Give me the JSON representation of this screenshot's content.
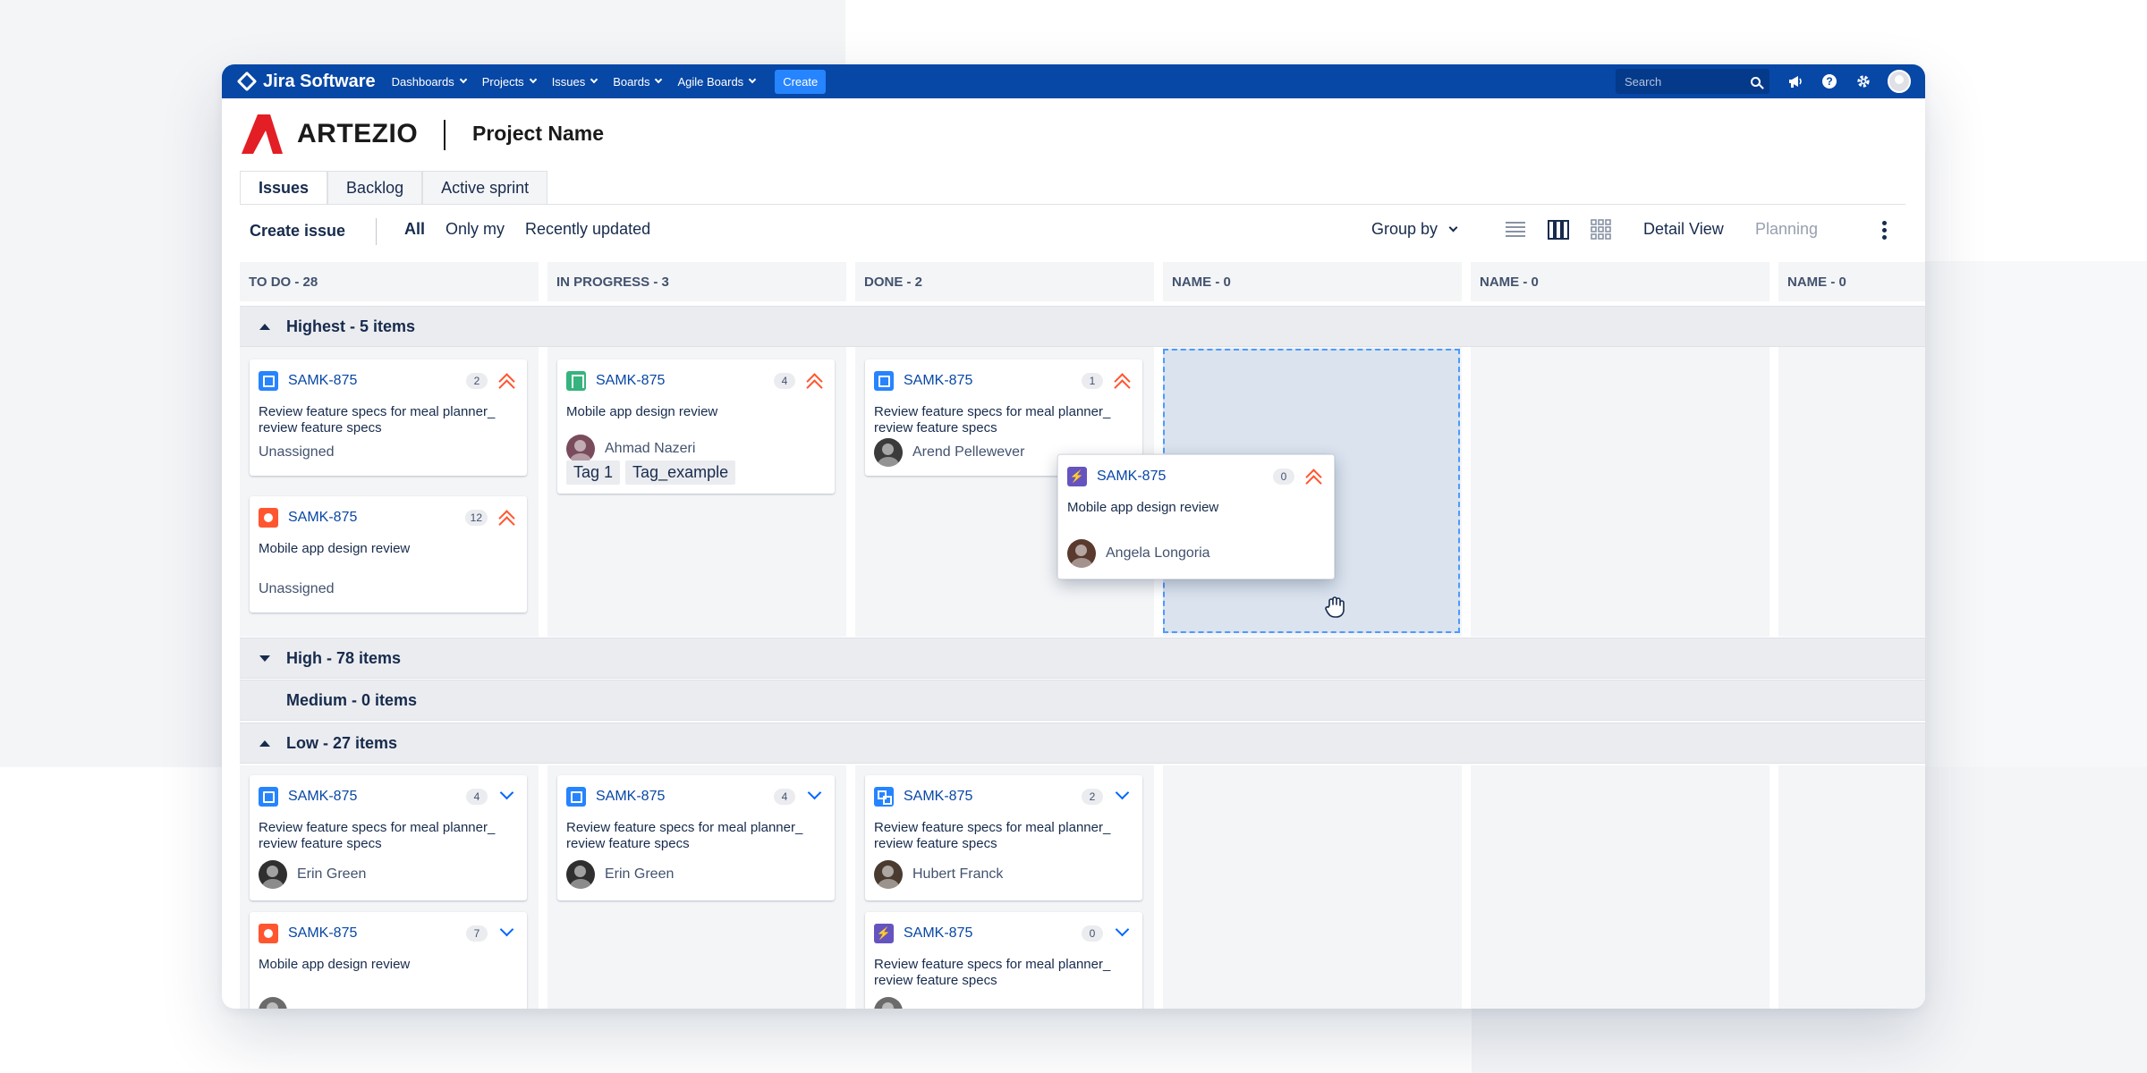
{
  "topnav": {
    "brand": "Jira Software",
    "items": [
      "Dashboards",
      "Projects",
      "Issues",
      "Boards",
      "Agile Boards"
    ],
    "create_label": "Create",
    "search_placeholder": "Search"
  },
  "header": {
    "logo_text": "ARTEZIO",
    "project_name": "Project Name"
  },
  "tabs": [
    "Issues",
    "Backlog",
    "Active sprint"
  ],
  "toolbar": {
    "create_issue": "Create issue",
    "filters": [
      "All",
      "Only my",
      "Recently updated"
    ],
    "group_by": "Group by",
    "detail_view": "Detail View",
    "planning": "Planning"
  },
  "columns": [
    "TO DO - 28",
    "IN PROGRESS - 3",
    "DONE - 2",
    "NAME - 0",
    "NAME - 0",
    "NAME - 0"
  ],
  "swimlanes": {
    "highest": "Highest - 5 items",
    "high": "High - 78 items",
    "medium": "Medium - 0 items",
    "low": "Low - 27 items"
  },
  "cards": {
    "c1": {
      "key": "SAMK-875",
      "count": "2",
      "title": "Review feature specs for meal planner_ review feature specs",
      "assignee": "Unassigned"
    },
    "c2": {
      "key": "SAMK-875",
      "count": "12",
      "title": "Mobile app design review",
      "assignee": "Unassigned"
    },
    "c3": {
      "key": "SAMK-875",
      "count": "4",
      "title": "Mobile app design review",
      "assignee": "Ahmad Nazeri",
      "tags": [
        "Tag 1",
        "Tag_example"
      ]
    },
    "c4": {
      "key": "SAMK-875",
      "count": "1",
      "title": "Review feature specs for meal planner_ review feature specs",
      "assignee": "Arend Pellewever"
    },
    "c5": {
      "key": "SAMK-875",
      "count": "0",
      "title": "Mobile app design review",
      "assignee": "Angela Longoria"
    },
    "c6": {
      "key": "SAMK-875",
      "count": "4",
      "title": "Review feature specs for meal planner_ review feature specs",
      "assignee": "Erin Green"
    },
    "c7": {
      "key": "SAMK-875",
      "count": "4",
      "title": "Review feature specs for meal planner_ review feature specs",
      "assignee": "Erin Green"
    },
    "c8": {
      "key": "SAMK-875",
      "count": "2",
      "title": "Review feature specs for meal planner_ review feature specs",
      "assignee": "Hubert Franck"
    },
    "c9": {
      "key": "SAMK-875",
      "count": "7",
      "title": "Mobile app design review"
    },
    "c10": {
      "key": "SAMK-875",
      "count": "0",
      "title": "Review feature specs for meal planner_ review feature specs"
    }
  },
  "colors": {
    "nav_bg": "#0747a6",
    "accent": "#2684ff",
    "priority_highest": "#ff5630",
    "priority_low": "#0065ff",
    "logo_red": "#e31e24",
    "drop_zone": "#dae3ee"
  }
}
